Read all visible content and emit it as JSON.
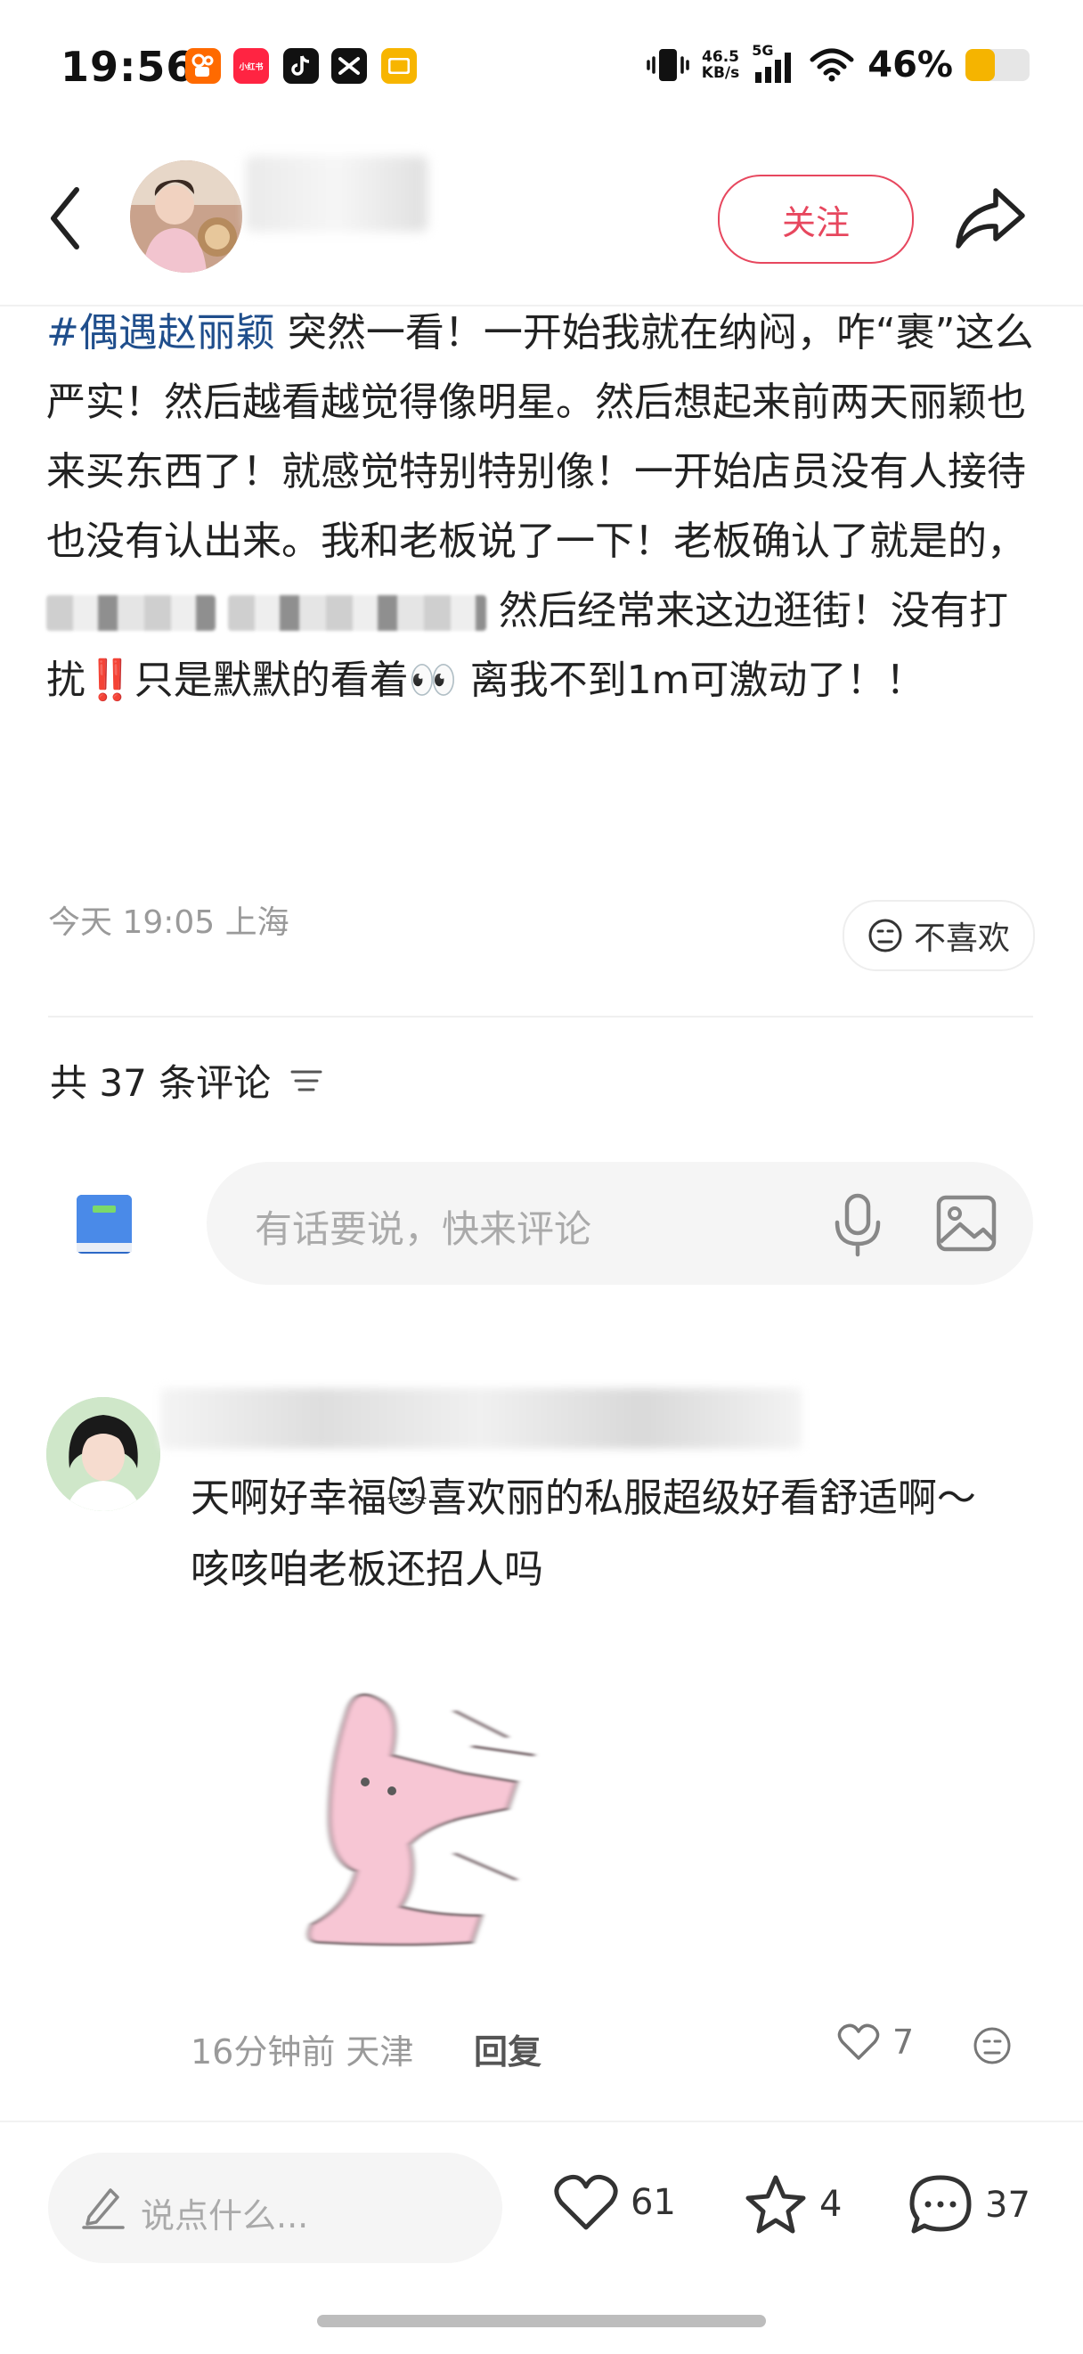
{
  "status_bar": {
    "time": "19:56",
    "net_speed_value": "46.5",
    "net_speed_unit": "KB/s",
    "signal_label": "5G",
    "battery": "46%",
    "battery_level": 0.46,
    "app_icons": [
      "kuaishou-icon",
      "xiaohongshu-icon",
      "douyin-icon",
      "capcut-icon",
      "notification-icon"
    ],
    "xhs_label": "小红书"
  },
  "header": {
    "follow_label": "关注"
  },
  "post": {
    "hashtag": "#偶遇赵丽颖",
    "text_1": " 突然一看！一开始我就在纳闷，咋“裹”这么严实！然后越看越觉得像明星。然后想起来前两天丽颖也来买东西了！就感觉特别特别像！一开始店员没有人接待也没有认出来。我和老板说了一下！老板确认了就是的，",
    "text_2": " 然后经常来这边逛街！没有打扰",
    "text_3": "只是默默的看着",
    "text_4": " 离我不到1m可激动了！！",
    "emoji_1": "‼️",
    "emoji_2": "👀",
    "meta": "今天 19:05 上海",
    "dislike_label": "不喜欢"
  },
  "comments": {
    "count_label": "共 37 条评论",
    "input_placeholder": "有话要说，快来评论",
    "items": [
      {
        "text_1": "天啊好幸福",
        "emoji": "😻",
        "text_2": "喜欢丽的私服超级好看舒适啊～咳咳咱老板还招人吗",
        "time_location": "16分钟前 天津",
        "reply_label": "回复",
        "likes": "7"
      }
    ]
  },
  "bottom_bar": {
    "placeholder": "说点什么...",
    "likes": "61",
    "favorites": "4",
    "comments": "37"
  },
  "colors": {
    "accent": "#e7475e",
    "hashtag": "#1f4e8c"
  }
}
